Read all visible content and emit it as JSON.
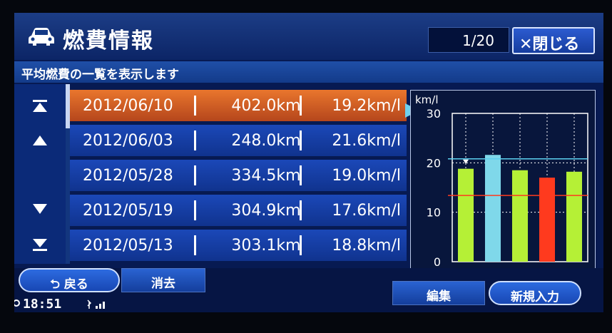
{
  "header": {
    "title": "燃費情報",
    "page_indicator": "1/20",
    "close_label": "✕閉じる"
  },
  "subtitle": "平均燃費の一覧を表示します",
  "scroll": {
    "buttons": [
      "top-icon",
      "up-icon",
      "down-icon",
      "bottom-icon"
    ]
  },
  "rows": [
    {
      "date": "2012/06/10",
      "distance": "402.0km",
      "efficiency": "19.2km/l",
      "selected": true
    },
    {
      "date": "2012/06/03",
      "distance": "248.0km",
      "efficiency": "21.6km/l",
      "selected": false
    },
    {
      "date": "2012/05/28",
      "distance": "334.5km",
      "efficiency": "19.0km/l",
      "selected": false
    },
    {
      "date": "2012/05/19",
      "distance": "304.9km",
      "efficiency": "17.6km/l",
      "selected": false
    },
    {
      "date": "2012/05/13",
      "distance": "303.1km",
      "efficiency": "18.8km/l",
      "selected": false
    }
  ],
  "chart_data": {
    "type": "bar",
    "ylabel": "km/l",
    "ylim": [
      0,
      30
    ],
    "yticks": [
      "30",
      "20",
      "10",
      "0"
    ],
    "values": [
      18.8,
      21.6,
      18.5,
      17.0,
      18.2
    ],
    "bar_colors": [
      "#b5f036",
      "#7fd8ea",
      "#b5f036",
      "#ff3a1e",
      "#b5f036"
    ],
    "reference_lines": [
      {
        "value": 20.8,
        "color": "#5bd0f0"
      },
      {
        "value": 13.4,
        "color": "#ff3a1e"
      }
    ],
    "grid": true
  },
  "footer": {
    "back_label": "戻る",
    "delete_label": "消去",
    "edit_label": "編集",
    "new_label": "新規入力",
    "clock": "18:51"
  },
  "colors": {
    "selected_row": "#d8612a",
    "row": "#1a46b2",
    "accent": "#2d6be0"
  }
}
